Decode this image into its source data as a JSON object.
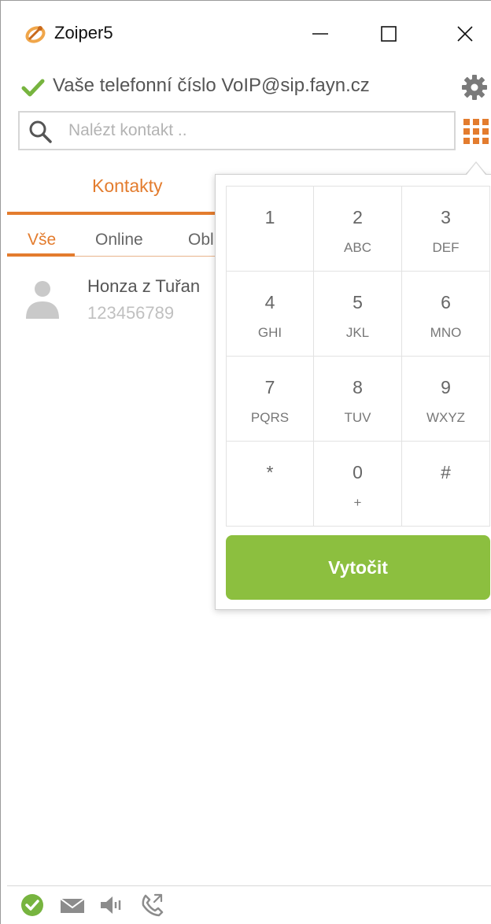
{
  "window": {
    "title": "Zoiper5",
    "icons": {
      "logo": "zoiper-logo-icon",
      "minimize": "minimize-icon",
      "maximize": "maximize-icon",
      "close": "close-icon"
    }
  },
  "status": {
    "text": "Vaše telefonní číslo VoIP@sip.fayn.cz",
    "icon": "check-icon",
    "settings_icon": "gear-icon",
    "accent_color": "#77b43f"
  },
  "search": {
    "placeholder": "Nalézt kontakt ..",
    "value": "",
    "icon": "search-icon",
    "dialpad_icon": "dialpad-grid-icon"
  },
  "tabs": {
    "main_label": "Kontakty",
    "subtabs": [
      {
        "label": "Vše",
        "active": true
      },
      {
        "label": "Online",
        "active": false
      },
      {
        "label": "Obl",
        "active": false
      }
    ],
    "accent_color": "#e37c2e"
  },
  "contacts": [
    {
      "name": "Honza z Tuřan",
      "number": "123456789",
      "avatar_icon": "person-icon"
    }
  ],
  "dialpad": {
    "keys": [
      {
        "digit": "1",
        "letters": ""
      },
      {
        "digit": "2",
        "letters": "ABC"
      },
      {
        "digit": "3",
        "letters": "DEF"
      },
      {
        "digit": "4",
        "letters": "GHI"
      },
      {
        "digit": "5",
        "letters": "JKL"
      },
      {
        "digit": "6",
        "letters": "MNO"
      },
      {
        "digit": "7",
        "letters": "PQRS"
      },
      {
        "digit": "8",
        "letters": "TUV"
      },
      {
        "digit": "9",
        "letters": "WXYZ"
      },
      {
        "digit": "*",
        "letters": ""
      },
      {
        "digit": "0",
        "letters": "+"
      },
      {
        "digit": "#",
        "letters": ""
      }
    ],
    "dial_label": "Vytočit",
    "dial_color": "#8cbf3f"
  },
  "status_bar": {
    "icons": [
      "status-ok-icon",
      "message-icon",
      "volume-icon",
      "call-history-icon"
    ]
  }
}
